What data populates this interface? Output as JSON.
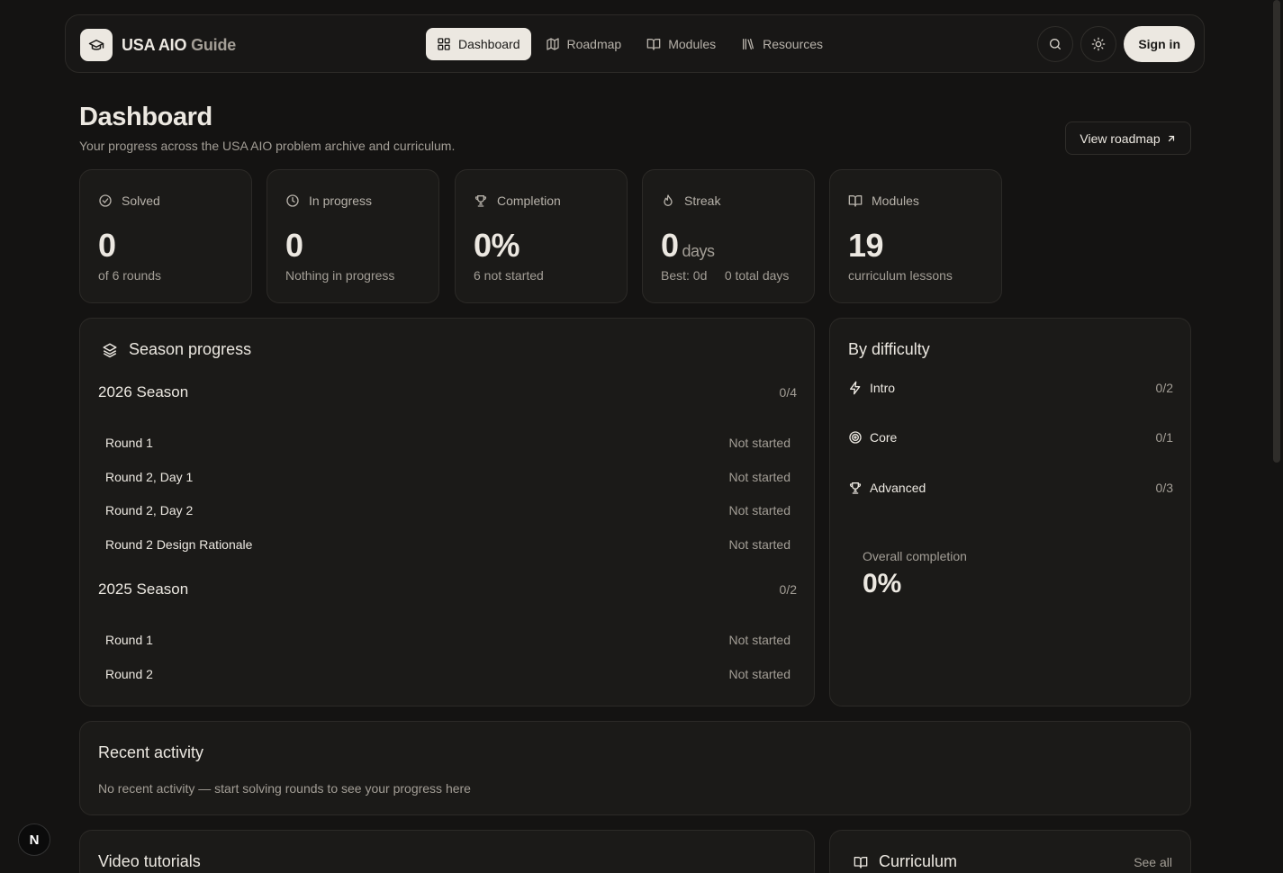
{
  "brand": {
    "name_bold": "USA AIO",
    "name_light": " Guide",
    "icon": "graduation-cap-icon"
  },
  "nav": {
    "items": [
      {
        "label": "Dashboard",
        "icon": "grid-icon",
        "active": true
      },
      {
        "label": "Roadmap",
        "icon": "map-icon",
        "active": false
      },
      {
        "label": "Modules",
        "icon": "book-open-icon",
        "active": false
      },
      {
        "label": "Resources",
        "icon": "library-icon",
        "active": false
      }
    ],
    "search_icon": "search-icon",
    "theme_icon": "sun-icon",
    "sign_in": "Sign in"
  },
  "header": {
    "title": "Dashboard",
    "subtitle": "Your progress across the USA AIO problem archive and curriculum.",
    "view_roadmap": "View roadmap"
  },
  "stats": [
    {
      "label": "Solved",
      "icon": "check-circle-icon",
      "value": "0",
      "unit": "",
      "note": "of 6 rounds"
    },
    {
      "label": "In progress",
      "icon": "clock-icon",
      "value": "0",
      "unit": "",
      "note": "Nothing in progress"
    },
    {
      "label": "Completion",
      "icon": "trophy-icon",
      "value": "0%",
      "unit": "",
      "note": "6 not started"
    },
    {
      "label": "Streak",
      "icon": "flame-icon",
      "value": "0",
      "unit": "days",
      "note": "Best: 0d     0 total days"
    },
    {
      "label": "Modules",
      "icon": "book-open-icon",
      "value": "19",
      "unit": "",
      "note": "curriculum lessons"
    }
  ],
  "season_progress": {
    "title": "Season progress",
    "seasons": [
      {
        "name": "2026 Season",
        "count": "0/4",
        "rounds": [
          {
            "name": "Round 1",
            "status": "Not started"
          },
          {
            "name": "Round 2, Day 1",
            "status": "Not started"
          },
          {
            "name": "Round 2, Day 2",
            "status": "Not started"
          },
          {
            "name": "Round 2 Design Rationale",
            "status": "Not started"
          }
        ]
      },
      {
        "name": "2025 Season",
        "count": "0/2",
        "rounds": [
          {
            "name": "Round 1",
            "status": "Not started"
          },
          {
            "name": "Round 2",
            "status": "Not started"
          }
        ]
      }
    ]
  },
  "difficulty": {
    "title": "By difficulty",
    "items": [
      {
        "label": "Intro",
        "icon": "zap-icon",
        "count": "0/2"
      },
      {
        "label": "Core",
        "icon": "target-icon",
        "count": "0/1"
      },
      {
        "label": "Advanced",
        "icon": "trophy-icon",
        "count": "0/3"
      }
    ],
    "overall_label": "Overall completion",
    "overall_value": "0%"
  },
  "recent_activity": {
    "title": "Recent activity",
    "empty": "No recent activity — start solving rounds to see your progress here"
  },
  "video_tutorials": {
    "title": "Video tutorials"
  },
  "curriculum": {
    "title": "Curriculum",
    "see_all": "See all"
  },
  "dev_badge": "N",
  "colors": {
    "background": "#141312",
    "card": "#1b1a18",
    "border": "#2c2a27",
    "accent": "#ece8e1",
    "muted": "#a39e96"
  }
}
